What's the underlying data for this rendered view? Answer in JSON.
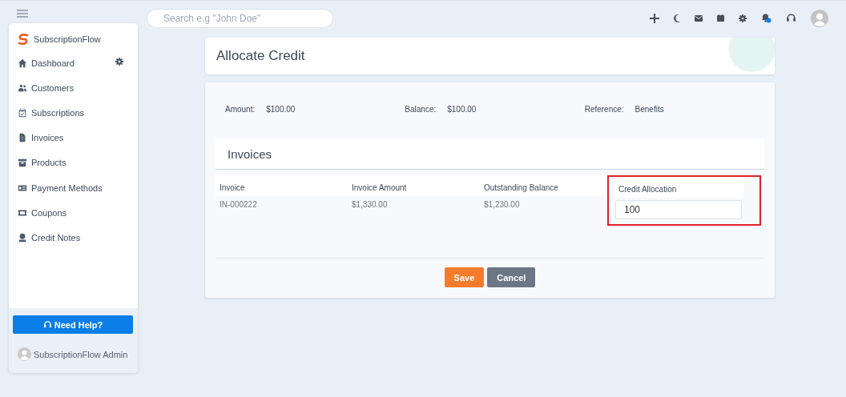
{
  "topbar": {
    "search": {
      "placeholder": "Search e.g \"John Doe\""
    }
  },
  "sidebar": {
    "brand": "SubscriptionFlow",
    "items": [
      {
        "label": "Dashboard",
        "settings": true
      },
      {
        "label": "Customers",
        "settings": false
      },
      {
        "label": "Subscriptions",
        "settings": false
      },
      {
        "label": "Invoices",
        "settings": false
      },
      {
        "label": "Products",
        "settings": false
      },
      {
        "label": "Payment Methods",
        "settings": false
      },
      {
        "label": "Coupons",
        "settings": false
      },
      {
        "label": "Credit Notes",
        "settings": false
      }
    ],
    "help_button": "Need Help?",
    "user": "SubscriptionFlow Admin"
  },
  "page": {
    "title": "Allocate Credit",
    "summary": [
      {
        "label": "Amount:",
        "value": "$100.00"
      },
      {
        "label": "Balance:",
        "value": "$100.00"
      },
      {
        "label": "Reference:",
        "value": "Benefits"
      }
    ],
    "section": "Invoices",
    "table": {
      "columns": [
        {
          "label": "Invoice",
          "highlighted": false
        },
        {
          "label": "Invoice Amount",
          "highlighted": false
        },
        {
          "label": "Outstanding Balance",
          "highlighted": false
        },
        {
          "label": "Credit Allocation",
          "highlighted": true
        }
      ],
      "rows": [
        {
          "invoice": "IN-000222",
          "invoice_amount": "$1,330.00",
          "outstanding_balance": "$1,230.00",
          "credit_allocation": "100"
        }
      ]
    },
    "buttons": [
      {
        "label": "Save",
        "kind": "primary"
      },
      {
        "label": "Cancel",
        "kind": "secondary"
      }
    ]
  }
}
